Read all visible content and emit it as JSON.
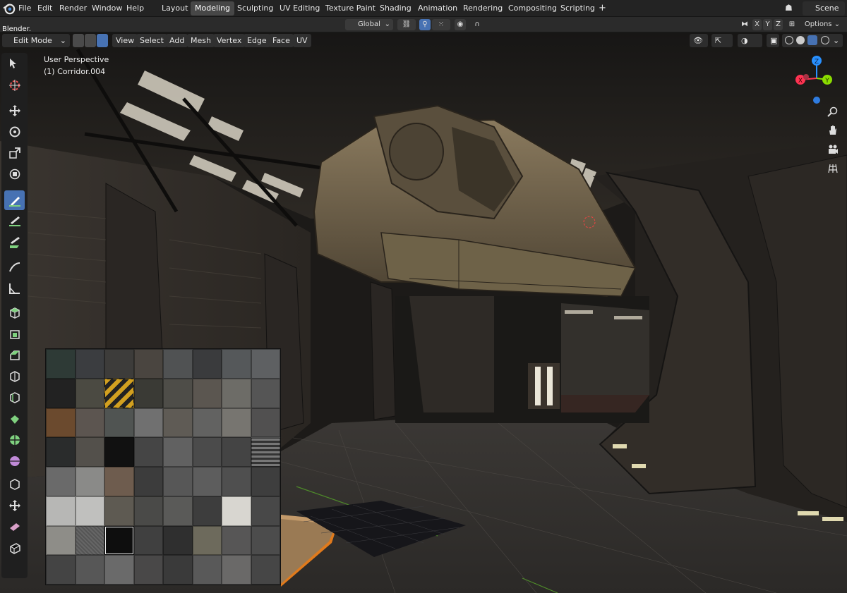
{
  "menu": {
    "items": [
      "File",
      "Edit",
      "Render",
      "Window",
      "Help"
    ]
  },
  "workspaces": [
    "Layout",
    "Modeling",
    "Sculpting",
    "UV Editing",
    "Texture Paint",
    "Shading",
    "Animation",
    "Rendering",
    "Compositing",
    "Scripting"
  ],
  "active_workspace": "Modeling",
  "add_workspace": "+",
  "scene": {
    "label": "Scene"
  },
  "status_left": "Blender.",
  "transform": {
    "orientation": "Global"
  },
  "axes": {
    "x": "X",
    "y": "Y",
    "z": "Z"
  },
  "options_label": "Options",
  "mode": {
    "label": "Edit Mode"
  },
  "header_menu": [
    "View",
    "Select",
    "Add",
    "Mesh",
    "Vertex",
    "Edge",
    "Face",
    "UV"
  ],
  "viewport": {
    "perspective": "User Perspective",
    "object": "(1) Corridor.004"
  },
  "gizmo": {
    "x": "X",
    "y": "Y",
    "z": "Z"
  },
  "icons": {
    "tools": [
      "select-box-icon",
      "cursor-icon",
      "move-icon",
      "rotate-icon",
      "scale-icon",
      "transform-icon",
      "annotate-icon",
      "annotate-line-icon",
      "annotate-polygon-icon",
      "measure-icon",
      "add-cube-icon",
      "extrude-icon",
      "inset-icon",
      "bevel-icon",
      "loop-cut-icon",
      "knife-icon",
      "poly-build-icon",
      "spin-icon",
      "smooth-icon",
      "edge-slide-icon",
      "shrink-icon",
      "shear-icon",
      "rip-icon"
    ],
    "nav": [
      "zoom-icon",
      "pan-hand-icon",
      "camera-icon",
      "grid-icon"
    ]
  },
  "colors": {
    "accent": "#4772b3",
    "gizmo_x": "#ff3352",
    "gizmo_y": "#8bdc00",
    "gizmo_z": "#2890ff"
  }
}
